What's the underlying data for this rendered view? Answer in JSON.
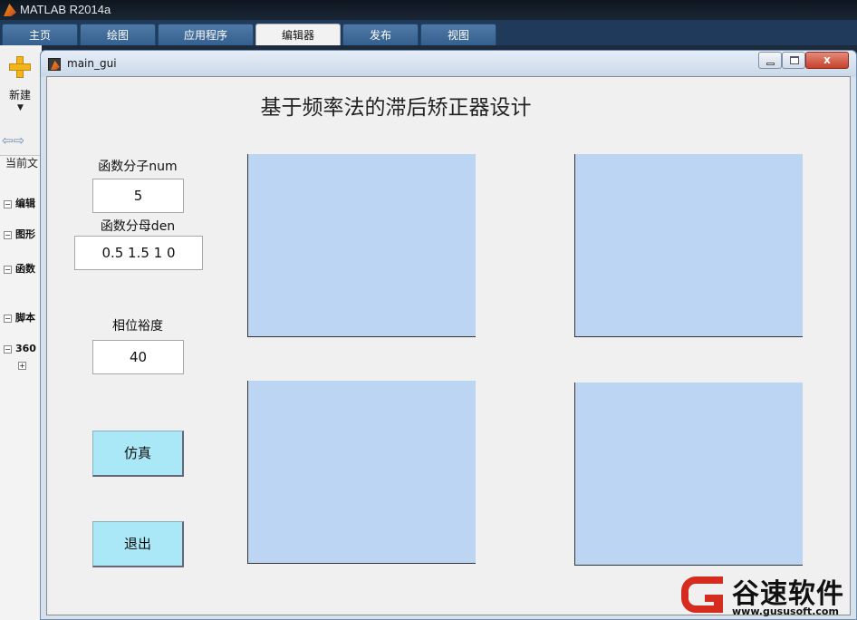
{
  "app": {
    "title": "MATLAB R2014a"
  },
  "tabs": [
    "主页",
    "绘图",
    "应用程序",
    "编辑器",
    "发布",
    "视图"
  ],
  "active_tab": "编辑器",
  "left_pane": {
    "new_label": "新建",
    "current_folder": "当前文",
    "tree": [
      "编辑",
      "图形",
      "函数",
      "脚本",
      "360"
    ]
  },
  "gui": {
    "window_title": "main_gui",
    "close_glyph": "x",
    "heading": "基于频率法的滞后矫正器设计",
    "numerator_label": "函数分子num",
    "numerator_value": "5",
    "denominator_label": "函数分母den",
    "denominator_value": "0.5 1.5 1 0",
    "phase_margin_label": "相位裕度",
    "phase_margin_value": "40",
    "simulate_button": "仿真",
    "exit_button": "退出"
  },
  "colors": {
    "axes_bg": "#bcd5f2",
    "button_bg": "#aae8f8",
    "tab_bg": "#35608e",
    "watermark_red": "#d62c20"
  },
  "watermark": {
    "brand": "谷速软件",
    "url": "www.gususoft.com"
  }
}
